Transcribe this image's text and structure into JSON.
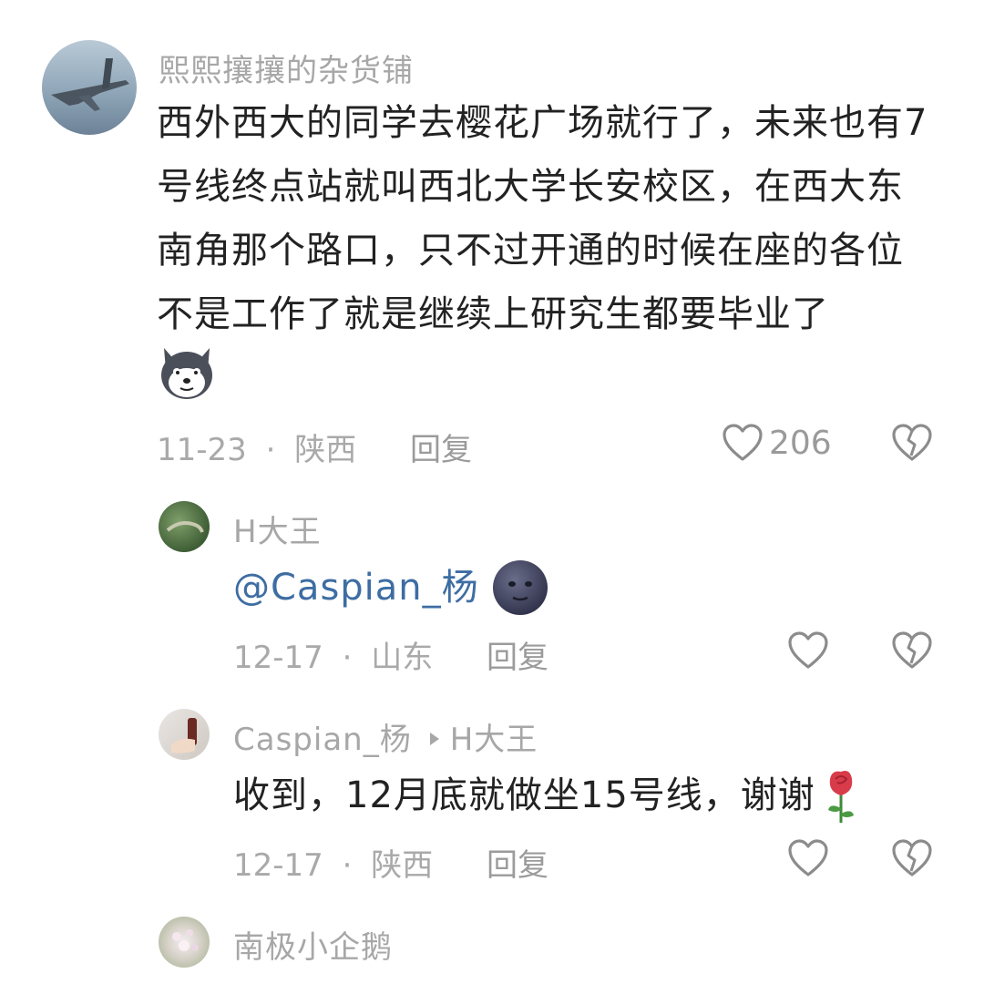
{
  "comments": [
    {
      "username": "熙熙攘攘的杂货铺",
      "text": "西外西大的同学去樱花广场就行了，未来也有7号线终点站就叫西北大学长安校区，在西大东南角那个路口，只不过开通的时候在座的各位不是工作了就是继续上研究生都要毕业了",
      "emoji_icon": "husky-sticker-icon",
      "date": "11-23",
      "location": "陕西",
      "reply_label": "回复",
      "likes": "206"
    }
  ],
  "replies": [
    {
      "username": "H大王",
      "mention": "@Caspian_杨",
      "emoji_icon": "new-moon-face-icon",
      "date": "12-17",
      "location": "山东",
      "reply_label": "回复"
    },
    {
      "username": "Caspian_杨",
      "reply_to": "H大王",
      "text": "收到，12月底就做坐15号线，谢谢",
      "emoji_icon": "rose-icon",
      "date": "12-17",
      "location": "陕西",
      "reply_label": "回复"
    },
    {
      "username": "南极小企鹅"
    }
  ],
  "separator": "·",
  "colors": {
    "mention": "#3d6da3",
    "meta": "#a9a9a9",
    "text": "#222222"
  }
}
